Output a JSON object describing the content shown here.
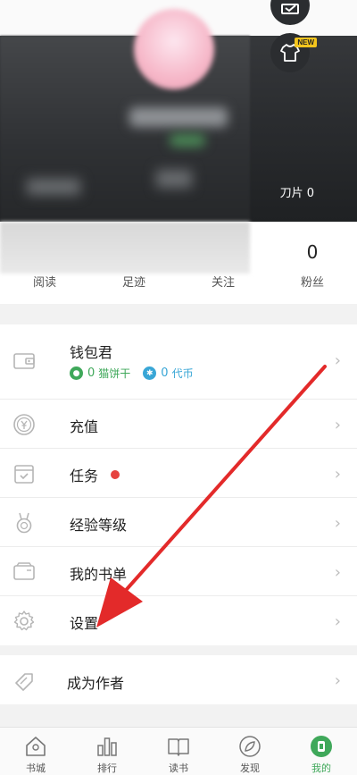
{
  "header": {
    "knife_text": "刀片 0",
    "new_badge": "NEW"
  },
  "stats": [
    {
      "label": "阅读",
      "value": ""
    },
    {
      "label": "足迹",
      "value": ""
    },
    {
      "label": "关注",
      "value": ""
    },
    {
      "label": "粉丝",
      "value": "0"
    }
  ],
  "wallet": {
    "label": "钱包君",
    "biscuit_value": "0",
    "biscuit_label": "猫饼干",
    "coin_value": "0",
    "coin_label": "代币"
  },
  "menu": [
    {
      "label": "充值",
      "icon": "yen-circle-icon"
    },
    {
      "label": "任务",
      "icon": "task-check-icon"
    },
    {
      "label": "经验等级",
      "icon": "medal-icon"
    },
    {
      "label": "我的书单",
      "icon": "booklist-icon"
    },
    {
      "label": "设置",
      "icon": "gear-icon"
    }
  ],
  "author": {
    "label": "成为作者",
    "icon": "pen-tag-icon"
  },
  "nav": [
    {
      "label": "书城",
      "icon": "house-icon"
    },
    {
      "label": "排行",
      "icon": "bar-chart-icon"
    },
    {
      "label": "读书",
      "icon": "open-book-icon"
    },
    {
      "label": "发现",
      "icon": "compass-leaf-icon"
    },
    {
      "label": "我的",
      "icon": "person-icon"
    }
  ],
  "colors": {
    "accent_green": "#3fa85a",
    "accent_blue": "#39a6d6",
    "red_dot": "#e64340",
    "arrow_red": "#e32a2a",
    "badge_yellow": "#f4c51d"
  }
}
